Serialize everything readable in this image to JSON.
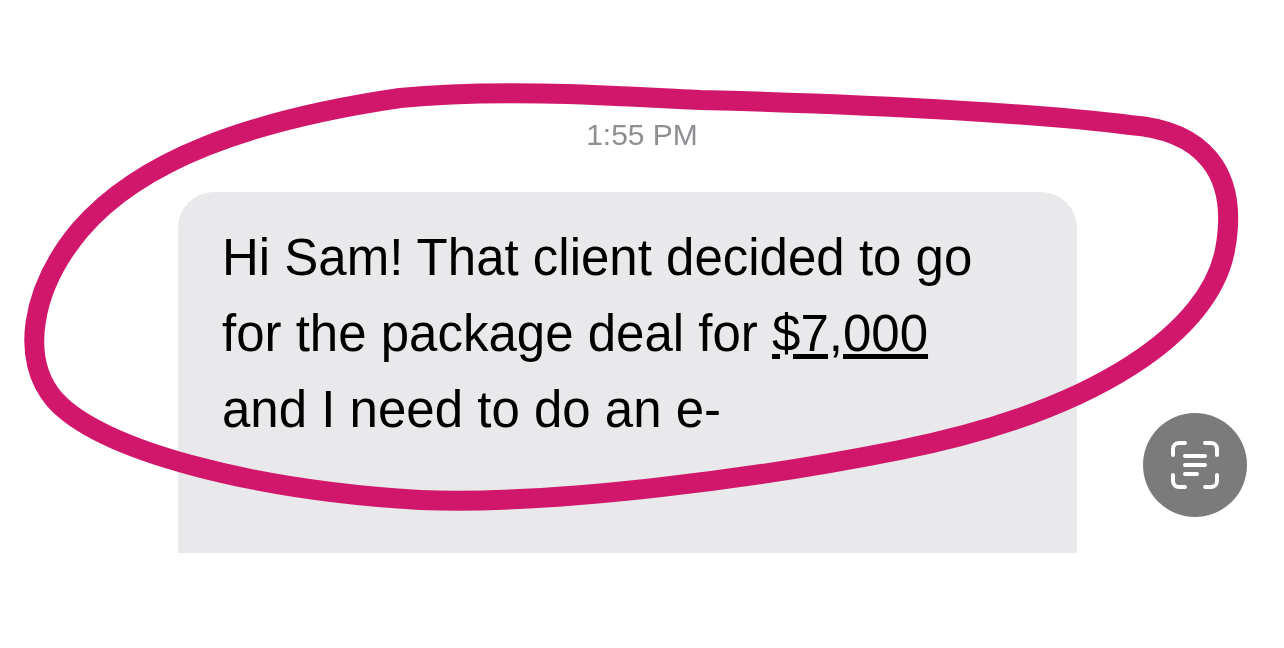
{
  "timestamp": "1:55 PM",
  "message": {
    "text_before": "Hi Sam! That client decided to go for the package deal for",
    "link": "$7,000",
    "text_after": "and I need to do an e-"
  },
  "live_text_button": {
    "kind": "live-text"
  }
}
